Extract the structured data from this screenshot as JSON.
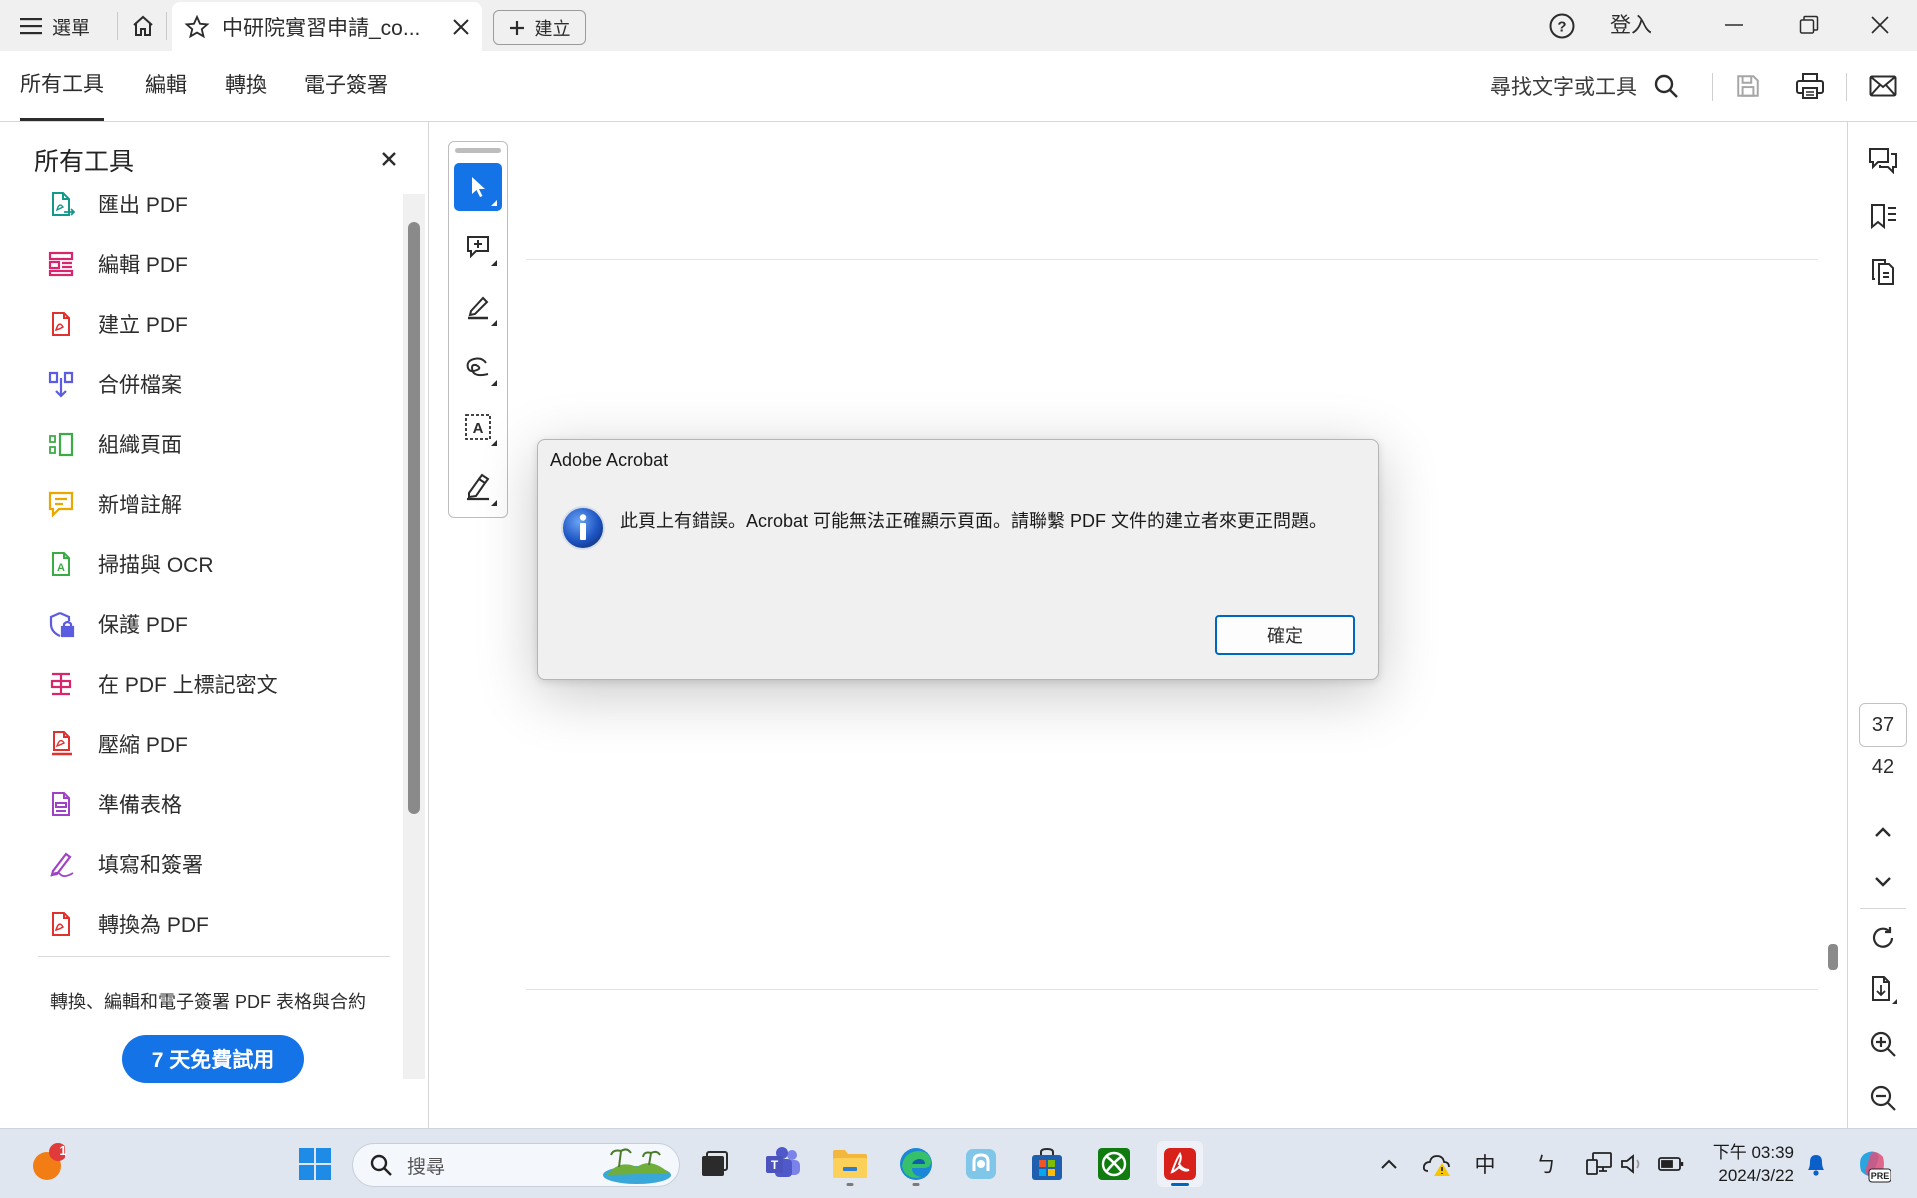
{
  "titlebar": {
    "menu_label": "選單",
    "tab_title": "中研院實習申請_co...",
    "create_label": "建立",
    "signin_label": "登入"
  },
  "toolbar": {
    "tabs": [
      "所有工具",
      "編輯",
      "轉換",
      "電子簽署"
    ],
    "search_label": "尋找文字或工具"
  },
  "left_panel": {
    "title": "所有工具",
    "items": [
      {
        "label": "匯出 PDF",
        "icon": "export-pdf-icon",
        "color": "#12998b"
      },
      {
        "label": "編輯 PDF",
        "icon": "edit-pdf-icon",
        "color": "#d8256e"
      },
      {
        "label": "建立 PDF",
        "icon": "create-pdf-icon",
        "color": "#e0312f"
      },
      {
        "label": "合併檔案",
        "icon": "combine-files-icon",
        "color": "#5c5ce0"
      },
      {
        "label": "組織頁面",
        "icon": "organize-pages-icon",
        "color": "#3bab45"
      },
      {
        "label": "新增註解",
        "icon": "add-comment-icon",
        "color": "#e8a800"
      },
      {
        "label": "掃描與 OCR",
        "icon": "scan-ocr-icon",
        "color": "#3bab45"
      },
      {
        "label": "保護 PDF",
        "icon": "protect-pdf-icon",
        "color": "#5c5ce0"
      },
      {
        "label": "在 PDF 上標記密文",
        "icon": "redact-icon",
        "color": "#d8256e"
      },
      {
        "label": "壓縮 PDF",
        "icon": "compress-pdf-icon",
        "color": "#e0312f"
      },
      {
        "label": "準備表格",
        "icon": "prepare-form-icon",
        "color": "#a042c8"
      },
      {
        "label": "填寫和簽署",
        "icon": "fill-sign-icon",
        "color": "#a042c8"
      },
      {
        "label": "轉換為 PDF",
        "icon": "convert-pdf-icon",
        "color": "#e0312f"
      }
    ],
    "promo_text": "轉換、編輯和電子簽署 PDF 表格與合約",
    "trial_button": "7 天免費試用"
  },
  "quick_tools": [
    "select-cursor-icon",
    "add-comment-icon",
    "highlight-pen-icon",
    "draw-freeform-icon",
    "text-recognition-icon",
    "sign-pen-icon"
  ],
  "right_rail": {
    "current_page": "37",
    "total_pages": "42"
  },
  "dialog": {
    "title": "Adobe Acrobat",
    "message": "此頁上有錯誤。Acrobat 可能無法正確顯示頁面。請聯繫 PDF 文件的建立者來更正問題。",
    "ok_label": "確定"
  },
  "taskbar": {
    "notification_badge": "1",
    "search_placeholder": "搜尋",
    "ime_label": "中",
    "ime_mode": "ㄅ",
    "clock_time": "下午 03:39",
    "clock_date": "2024/3/22"
  },
  "colors": {
    "accent": "#1473e6",
    "dialog_button_border": "#0067c0"
  }
}
